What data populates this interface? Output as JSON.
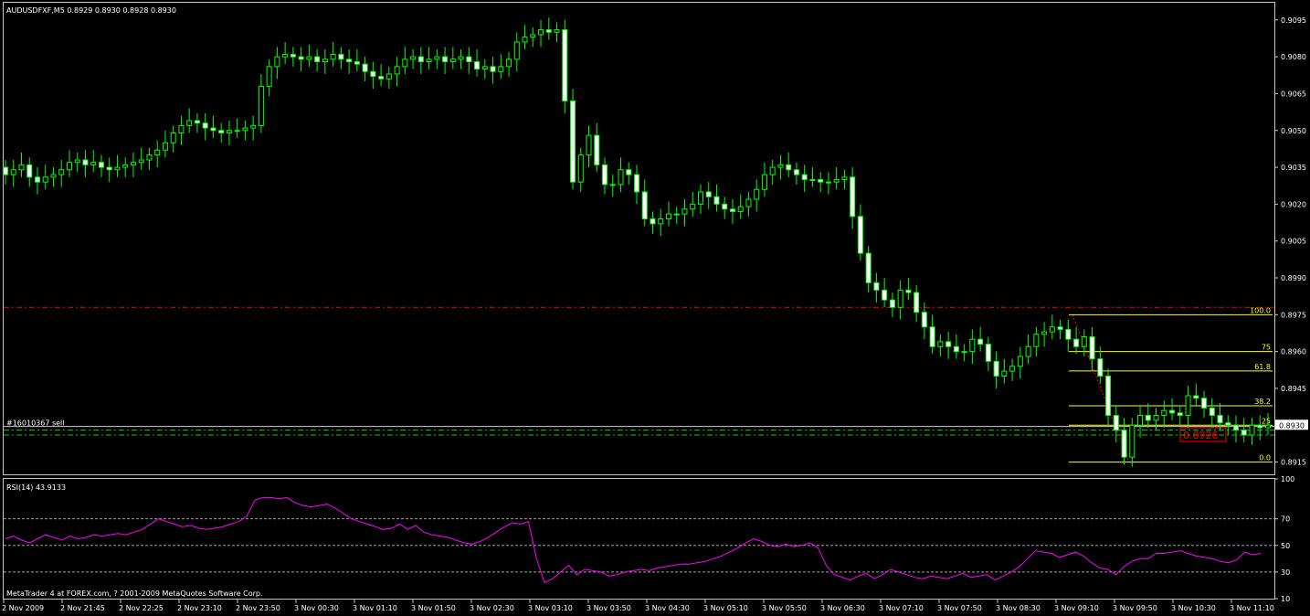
{
  "colors": {
    "background": "#000000",
    "frame": "#c8c8c8",
    "bull_candle": "#000000",
    "bear_candle": "#ffffff",
    "wick": "#00ff00",
    "fib": "#ffff00",
    "fib_label": "#ffff00",
    "resistance_line": "#ff0000",
    "order_line": "#00cc00",
    "rsi_line": "#ff00ff",
    "rsi_level": "#a0a0a0",
    "text": "#ffffff"
  },
  "chart_data": [
    {
      "type": "candlestick",
      "title": "AUDUSDFXF,M5  0.8929 0.8930 0.8928 0.8930",
      "ylim": [
        0.891,
        0.9102
      ],
      "y_ticks": [
        "0.9095",
        "0.9080",
        "0.9065",
        "0.9050",
        "0.9035",
        "0.9020",
        "0.9005",
        "0.8990",
        "0.8975",
        "0.8960",
        "0.8945",
        "0.8915"
      ],
      "current_price_label": "0.8930",
      "x_ticks": [
        "2 Nov 2009",
        "2 Nov 21:45",
        "2 Nov 22:25",
        "2 Nov 23:10",
        "2 Nov 23:50",
        "3 Nov 00:30",
        "3 Nov 01:10",
        "3 Nov 01:50",
        "3 Nov 02:30",
        "3 Nov 03:10",
        "3 Nov 03:50",
        "3 Nov 04:30",
        "3 Nov 05:10",
        "3 Nov 05:50",
        "3 Nov 06:30",
        "3 Nov 07:10",
        "3 Nov 07:50",
        "3 Nov 08:30",
        "3 Nov 09:10",
        "3 Nov 09:50",
        "3 Nov 10:30",
        "3 Nov 11:10"
      ],
      "closes": [
        0.9032,
        0.9034,
        0.9036,
        0.9031,
        0.9029,
        0.9031,
        0.9032,
        0.9034,
        0.9037,
        0.9038,
        0.9036,
        0.9037,
        0.9035,
        0.9034,
        0.9035,
        0.9036,
        0.9037,
        0.9038,
        0.904,
        0.9042,
        0.9045,
        0.9049,
        0.9052,
        0.9054,
        0.9053,
        0.9051,
        0.905,
        0.9049,
        0.905,
        0.905,
        0.9051,
        0.9052,
        0.9068,
        0.9076,
        0.908,
        0.9081,
        0.908,
        0.9079,
        0.908,
        0.9078,
        0.9079,
        0.9081,
        0.9079,
        0.9078,
        0.9077,
        0.9074,
        0.9072,
        0.9071,
        0.9073,
        0.9076,
        0.9079,
        0.908,
        0.9078,
        0.9079,
        0.908,
        0.9078,
        0.9079,
        0.908,
        0.9078,
        0.9075,
        0.9076,
        0.9074,
        0.9076,
        0.9079,
        0.9086,
        0.9088,
        0.9089,
        0.9091,
        0.909,
        0.9091,
        0.9062,
        0.9029,
        0.904,
        0.9048,
        0.9036,
        0.9028,
        0.9028,
        0.9034,
        0.9032,
        0.9025,
        0.9014,
        0.9012,
        0.9014,
        0.9016,
        0.9016,
        0.9018,
        0.902,
        0.9025,
        0.9023,
        0.902,
        0.9018,
        0.9017,
        0.9019,
        0.9022,
        0.9026,
        0.9032,
        0.9035,
        0.9036,
        0.9034,
        0.9032,
        0.903,
        0.903,
        0.9029,
        0.9029,
        0.903,
        0.9031,
        0.9015,
        0.9,
        0.8988,
        0.8985,
        0.8981,
        0.8978,
        0.8985,
        0.8984,
        0.8976,
        0.897,
        0.8962,
        0.8964,
        0.8962,
        0.896,
        0.896,
        0.8965,
        0.8963,
        0.8956,
        0.895,
        0.8952,
        0.8954,
        0.8958,
        0.8962,
        0.8967,
        0.8968,
        0.897,
        0.8969,
        0.8965,
        0.8962,
        0.8966,
        0.8957,
        0.895,
        0.8934,
        0.8928,
        0.8917,
        0.893,
        0.8934,
        0.8932,
        0.8934,
        0.8936,
        0.8935,
        0.8934,
        0.8942,
        0.8941,
        0.8937,
        0.8934,
        0.8931,
        0.893,
        0.8928,
        0.8926,
        0.893,
        0.8929,
        0.893
      ],
      "horizontal_lines": [
        {
          "price": 0.8978,
          "style": "dash-dot"
        },
        {
          "price": 0.89295,
          "style": "solid",
          "label": "#16010367 sell"
        },
        {
          "price": 0.8928,
          "style": "dash-dot"
        },
        {
          "price": 0.8926,
          "style": "dash-dot"
        }
      ],
      "fibonacci": {
        "high": 0.8975,
        "low": 0.8915,
        "levels": [
          {
            "ratio": 1.0,
            "label": "100.0"
          },
          {
            "ratio": 0.75,
            "label": "75"
          },
          {
            "ratio": 0.618,
            "label": "61.8"
          },
          {
            "ratio": 0.382,
            "label": "38.2"
          },
          {
            "ratio": 0.25,
            "label": "25"
          },
          {
            "ratio": 0.0,
            "label": "0.0"
          }
        ]
      },
      "price_tag": "0.8926"
    },
    {
      "type": "line",
      "title": "RSI(14) 43.9133",
      "ylim": [
        10,
        100
      ],
      "y_ticks": [
        "100",
        "70",
        "50",
        "30",
        "10"
      ],
      "levels": [
        70,
        50,
        30
      ],
      "values": [
        55,
        57,
        54,
        52,
        55,
        58,
        56,
        54,
        57,
        55,
        56,
        58,
        57,
        58,
        59,
        58,
        60,
        62,
        66,
        70,
        68,
        66,
        64,
        65,
        63,
        62,
        63,
        64,
        66,
        68,
        72,
        84,
        86,
        86,
        85,
        86,
        82,
        80,
        79,
        80,
        81,
        78,
        74,
        70,
        68,
        66,
        64,
        62,
        63,
        66,
        62,
        65,
        60,
        58,
        57,
        56,
        54,
        52,
        51,
        53,
        56,
        60,
        64,
        67,
        66,
        68,
        40,
        22,
        25,
        30,
        35,
        28,
        32,
        31,
        30,
        27,
        28,
        30,
        31,
        32,
        31,
        33,
        34,
        35,
        36,
        36,
        37,
        38,
        40,
        42,
        45,
        48,
        52,
        55,
        53,
        50,
        49,
        51,
        49,
        50,
        52,
        48,
        35,
        28,
        26,
        24,
        27,
        29,
        25,
        28,
        32,
        30,
        28,
        26,
        25,
        27,
        26,
        25,
        27,
        29,
        26,
        27,
        28,
        24,
        27,
        30,
        34,
        40,
        46,
        45,
        44,
        41,
        43,
        45,
        42,
        37,
        33,
        32,
        28,
        34,
        38,
        40,
        40,
        44,
        44,
        45,
        46,
        44,
        42,
        41,
        40,
        38,
        37,
        39,
        45,
        43,
        44
      ]
    }
  ],
  "footer": {
    "copyright": "MetaTrader 4 at FOREX.com, ? 2001-2009 MetaQuotes Software Corp."
  }
}
